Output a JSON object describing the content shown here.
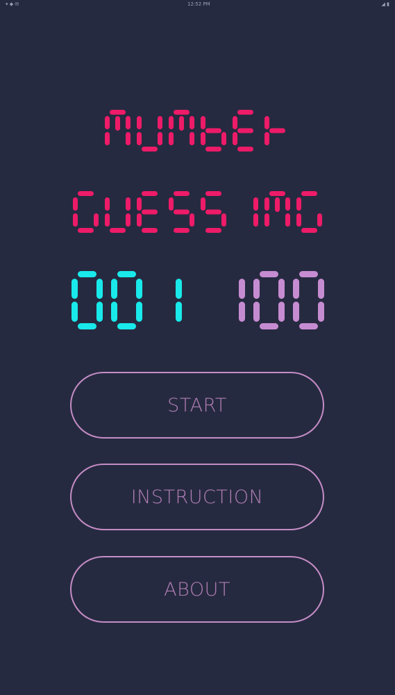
{
  "status_bar": {
    "left": "▾ ◆ ✉",
    "time": "12:52 PM",
    "right": "◢ ▮"
  },
  "title": {
    "line1": "NUMBER",
    "line2": "GUESSING"
  },
  "range": {
    "min": "001",
    "max": "100"
  },
  "menu": {
    "start_label": "START",
    "instruction_label": "INSTRUCTION",
    "about_label": "ABOUT"
  },
  "colors": {
    "background": "#262a40",
    "title": "#ee1b68",
    "range_min": "#19e9ea",
    "range_max": "#c68cd1",
    "button_border": "#c58dc6",
    "button_text": "#b07eb4"
  }
}
